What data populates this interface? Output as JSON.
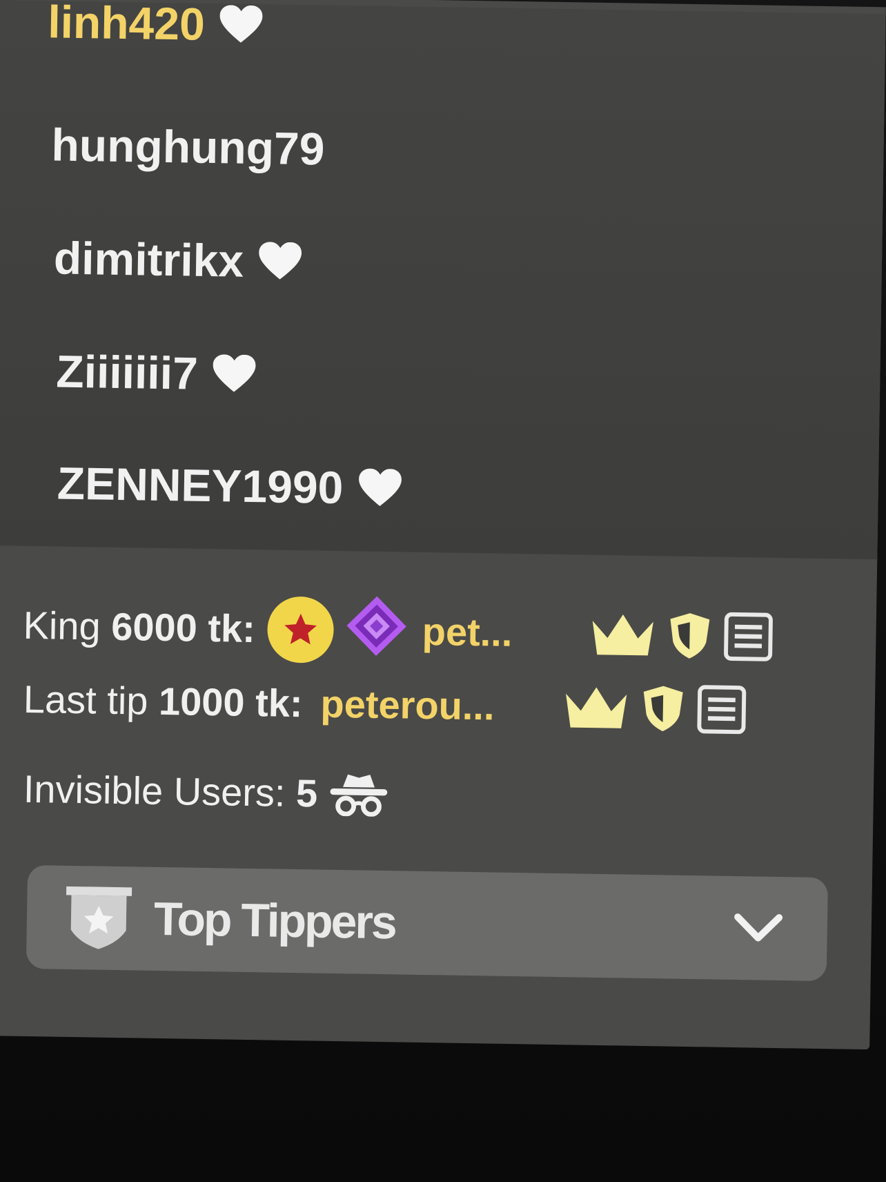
{
  "users": [
    {
      "name": "linh420",
      "heart": true,
      "highlight": true
    },
    {
      "name": "hunghung79",
      "heart": false,
      "highlight": false
    },
    {
      "name": "dimitrikx",
      "heart": true,
      "highlight": false
    },
    {
      "name": "Ziiiiiii7",
      "heart": true,
      "highlight": false
    },
    {
      "name": "ZENNEY1990",
      "heart": true,
      "highlight": false
    }
  ],
  "king": {
    "label": "King",
    "amount": "6000 tk:",
    "user": "pet..."
  },
  "last_tip": {
    "label": "Last tip",
    "amount": "1000 tk:",
    "user": "peterou..."
  },
  "invisible": {
    "label": "Invisible Users:",
    "count": "5"
  },
  "top_tippers": {
    "label": "Top Tippers"
  },
  "colors": {
    "panel": "#4a4a48",
    "gold": "#f3d368",
    "text": "#f1f1f1",
    "coin": "#f2d64a",
    "diamond": "#a64ee8",
    "crown": "#f6eea0"
  },
  "icons": [
    "heart-icon",
    "star-coin-icon",
    "diamond-icon",
    "crown-icon",
    "shield-icon",
    "notes-icon",
    "incognito-icon",
    "trophy-shield-icon",
    "chevron-down-icon"
  ]
}
